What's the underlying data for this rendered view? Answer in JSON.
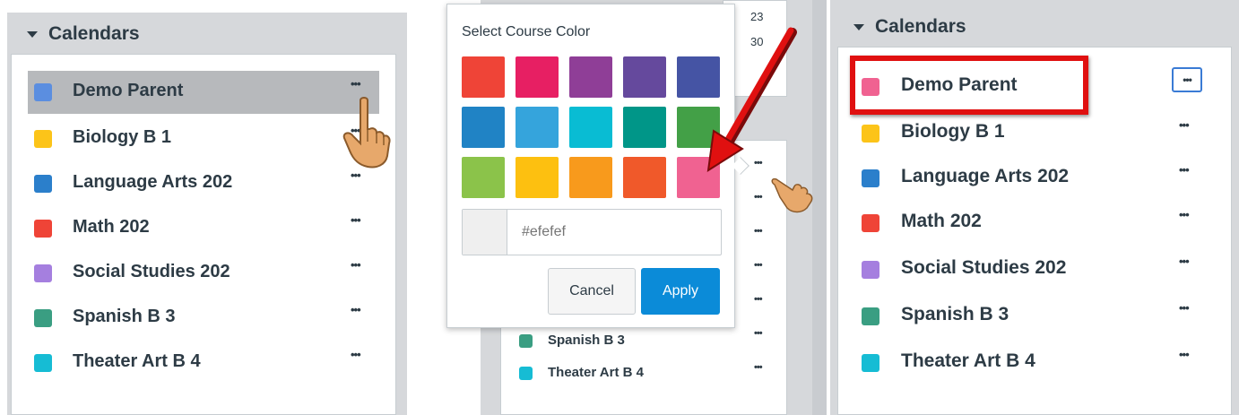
{
  "panel1": {
    "header": "Calendars",
    "items": [
      {
        "label": "Demo Parent",
        "color": "#5b8ee0",
        "selected": true
      },
      {
        "label": "Biology B 1",
        "color": "#fcc419"
      },
      {
        "label": "Language Arts 202",
        "color": "#2b7fcb"
      },
      {
        "label": "Math 202",
        "color": "#ef4437"
      },
      {
        "label": "Social Studies 202",
        "color": "#a57fdf"
      },
      {
        "label": "Spanish B 3",
        "color": "#3a9e82"
      },
      {
        "label": "Theater Art B 4",
        "color": "#16bcd4"
      }
    ],
    "options_glyph": "•••"
  },
  "panel2": {
    "popover_title": "Select Course Color",
    "colors": [
      "#ef4437",
      "#e71f63",
      "#8f3e97",
      "#65499d",
      "#4554a4",
      "#2083c5",
      "#35a4dc",
      "#09bcd3",
      "#009688",
      "#43a047",
      "#8bc34a",
      "#fdc010",
      "#f89a1c",
      "#f0592a",
      "#f06291"
    ],
    "hex_placeholder": "#efefef",
    "hex_swatch": "#efefef",
    "cancel_label": "Cancel",
    "apply_label": "Apply",
    "calendar_days": [
      "23",
      "30"
    ],
    "items": [
      {
        "label": "Spanish B 3",
        "color": "#3a9e82"
      },
      {
        "label": "Theater Art B 4",
        "color": "#16bcd4"
      }
    ],
    "options_glyph": "•••",
    "accent": "#0b8bd8",
    "arrow_color": "#e01010"
  },
  "panel3": {
    "header": "Calendars",
    "items": [
      {
        "label": "Demo Parent",
        "color": "#f06291",
        "highlighted": true
      },
      {
        "label": "Biology B 1",
        "color": "#fcc419"
      },
      {
        "label": "Language Arts 202",
        "color": "#2b7fcb"
      },
      {
        "label": "Math 202",
        "color": "#ef4437"
      },
      {
        "label": "Social Studies 202",
        "color": "#a57fdf"
      },
      {
        "label": "Spanish B 3",
        "color": "#3a9e82"
      },
      {
        "label": "Theater Art B 4",
        "color": "#16bcd4"
      }
    ],
    "options_glyph": "•••"
  }
}
